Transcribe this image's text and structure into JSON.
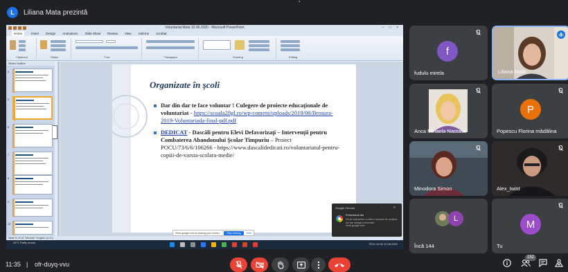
{
  "meet": {
    "presenter_initial": "L",
    "presenter_text": "Liliana Mata prezintă",
    "top_mark": "’"
  },
  "ppt": {
    "window_title": "Voluntariat Mata 10.06.2020 - Microsoft PowerPoint",
    "window_controls": "– □ ×",
    "tabs": [
      "Home",
      "Insert",
      "Design",
      "Animations",
      "Slide Show",
      "Review",
      "View",
      "Add-Ins",
      "Acrobat"
    ],
    "ribbon_groups": [
      "Clipboard",
      "Slides",
      "Font",
      "Paragraph",
      "Drawing",
      "Editing"
    ],
    "left_tabs": "Slides  Outline",
    "thumb_numbers": [
      "4",
      "5",
      "6",
      "7",
      "8",
      "9",
      "10"
    ],
    "status_text": "Slide 5 of 19   \"Module\"   English (U.S.)",
    "slide": {
      "title": "Organizate în şcoli",
      "b1_bold": "Dar din dar te face voluntar ! Culegere de proiecte educaţionale de voluntariat",
      "b1_sep": " - ",
      "b1_link": "https://scoala28gl.ro/wp-content/uploads/2019/08/Brosura-2019-Voluntariada-final-pdf.pdf",
      "b2_link": "DEDICAT",
      "b2_bold": " - Dascăli pentru Elevi Defavorizaţi – Intervenţii pentru Combaterea Abandonului Şcolar Timpuriu",
      "b2_rest": " – Proiect POCU/73/6/6/106266 - https://www.dascalidedicati.ro/voluntariatul-pentru-copiii-de-varsta-scolara-medie/"
    },
    "share_banner": {
      "text": "meet.google.com is sharing your screen.",
      "stop": "Stop sharing",
      "hide": "Hide"
    },
    "toast": {
      "header": "Google Chrome",
      "title": "Prezentarea dvs",
      "body": "Vă ati rulat pentru a oferi o sesiune de conţinut din tab mesaje prezentate",
      "site": "meet.google.com"
    },
    "taskbar": {
      "weather": "29°C Partly sunny",
      "tray": "ROU  10:30  10.06.2020"
    }
  },
  "participants": [
    {
      "name": "fudulu mirela",
      "initial": "f",
      "color": "#7e57c2",
      "muted": true
    },
    {
      "name": "Liliana Mata",
      "speaking": true
    },
    {
      "name": "Anca Mihaela Nastasa",
      "muted": true
    },
    {
      "name": "Popescu Florina mădălina",
      "initial": "P",
      "color": "#e8710a",
      "muted": true
    },
    {
      "name": "Minodora Simon",
      "muted": true
    },
    {
      "name": "Alex_twist",
      "muted": true
    },
    {
      "name": "Încă 144",
      "initial": "L",
      "color": "#8e44ad"
    },
    {
      "name": "Tu",
      "initial": "M",
      "color": "#9c4dcc",
      "muted": true
    }
  ],
  "bottom": {
    "time": "11:35",
    "separator": "|",
    "code": "ofr-duyq-vvu",
    "participants_count": "152",
    "icons": [
      "mic-off-icon",
      "camera-off-icon",
      "raise-hand-icon",
      "present-icon",
      "more-options-icon",
      "end-call-icon",
      "info-icon",
      "people-icon",
      "chat-icon",
      "activities-icon"
    ]
  }
}
